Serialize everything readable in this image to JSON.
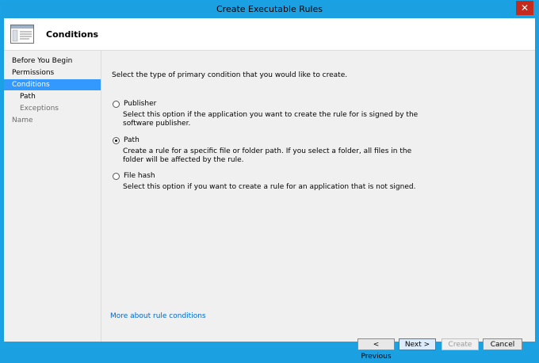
{
  "window": {
    "title": "Create Executable Rules",
    "close_label": "✕"
  },
  "header": {
    "title": "Conditions",
    "icon": "wizard-page-icon"
  },
  "sidebar": {
    "items": [
      {
        "label": "Before You Begin"
      },
      {
        "label": "Permissions"
      },
      {
        "label": "Conditions",
        "selected": true
      },
      {
        "label": "Path"
      },
      {
        "label": "Exceptions"
      },
      {
        "label": "Name"
      }
    ]
  },
  "main": {
    "prompt": "Select the type of primary condition that you would like to create.",
    "options": [
      {
        "label": "Publisher",
        "checked": false,
        "desc_line1": "Select this option if the application you want to create the rule for is signed by the",
        "desc_line2": "software publisher."
      },
      {
        "label": "Path",
        "checked": true,
        "desc_line1": "Create a rule for a specific file or folder path. If you select a folder, all files in the",
        "desc_line2": "folder will be affected by the rule."
      },
      {
        "label": "File hash",
        "checked": false,
        "desc_line1": "Select this option if you want to create a rule for an application that is not signed."
      }
    ],
    "more_link": "More about rule conditions"
  },
  "buttons": {
    "previous": "< Previous",
    "next": "Next >",
    "create": "Create",
    "cancel": "Cancel"
  }
}
